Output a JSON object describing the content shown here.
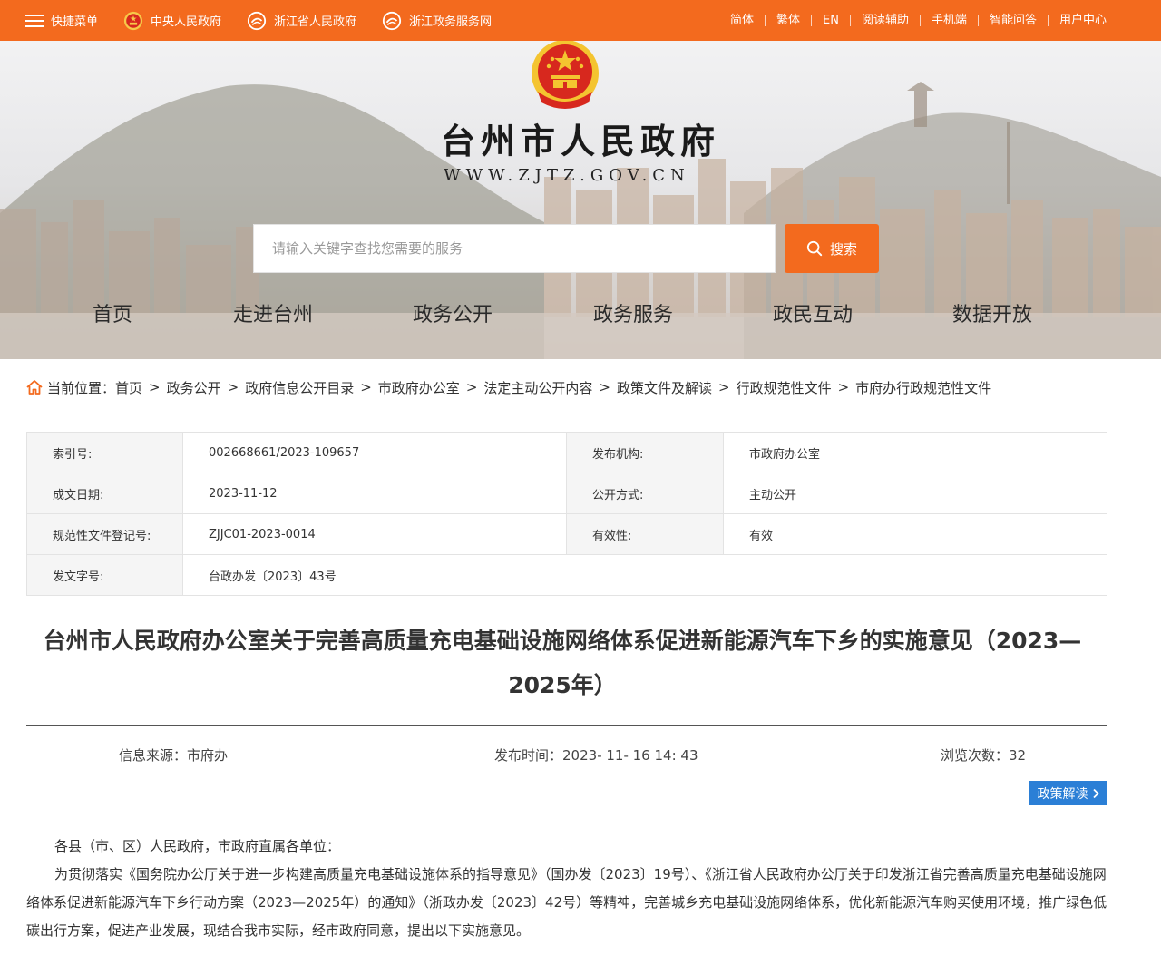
{
  "topbar": {
    "quick_menu": "快捷菜单",
    "links_left": [
      "中央人民政府",
      "浙江省人民政府",
      "浙江政务服务网"
    ],
    "links_right": [
      "简体",
      "繁体",
      "EN",
      "阅读辅助",
      "手机端",
      "智能问答",
      "用户中心"
    ]
  },
  "header": {
    "title": "台州市人民政府",
    "url": "WWW.ZJTZ.GOV.CN",
    "search_placeholder": "请输入关键字查找您需要的服务",
    "search_button": "搜索",
    "nav": [
      "首页",
      "走进台州",
      "政务公开",
      "政务服务",
      "政民互动",
      "数据开放"
    ]
  },
  "breadcrumb": {
    "prefix": "当前位置：",
    "items": [
      "首页",
      "政务公开",
      "政府信息公开目录",
      "市政府办公室",
      "法定主动公开内容",
      "政策文件及解读",
      "行政规范性文件",
      "市府办行政规范性文件"
    ],
    "separator": ">"
  },
  "meta": {
    "rows": [
      {
        "k1": "索引号:",
        "v1": "002668661/2023-109657",
        "k2": "发布机构:",
        "v2": "市政府办公室"
      },
      {
        "k1": "成文日期:",
        "v1": "2023-11-12",
        "k2": "公开方式:",
        "v2": "主动公开"
      },
      {
        "k1": "规范性文件登记号:",
        "v1": "ZJJC01-2023-0014",
        "k2": "有效性:",
        "v2": "有效"
      },
      {
        "k1": "发文字号:",
        "v1": "台政办发〔2023〕43号"
      }
    ]
  },
  "article": {
    "title": "台州市人民政府办公室关于完善高质量充电基础设施网络体系促进新能源汽车下乡的实施意见（2023—2025年）",
    "source_label": "信息来源：",
    "source": "市府办",
    "time_label": "发布时间：",
    "time": "2023- 11- 16 14: 43",
    "views_label": "浏览次数：",
    "views": "32",
    "policy_button": "政策解读",
    "salutation": "各县（市、区）人民政府，市政府直属各单位：",
    "paragraph": "为贯彻落实《国务院办公厅关于进一步构建高质量充电基础设施体系的指导意见》（国办发〔2023〕19号）、《浙江省人民政府办公厅关于印发浙江省完善高质量充电基础设施网络体系促进新能源汽车下乡行动方案（2023—2025年）的通知》（浙政办发〔2023〕42号）等精神，完善城乡充电基础设施网络体系，优化新能源汽车购买使用环境，推广绿色低碳出行方案，促进产业发展，现结合我市实际，经市政府同意，提出以下实施意见。"
  },
  "colors": {
    "accent_orange": "#f36a1e",
    "policy_blue": "#2b7fd6",
    "emblem_red": "#d7281e",
    "emblem_gold": "#f4c430"
  }
}
